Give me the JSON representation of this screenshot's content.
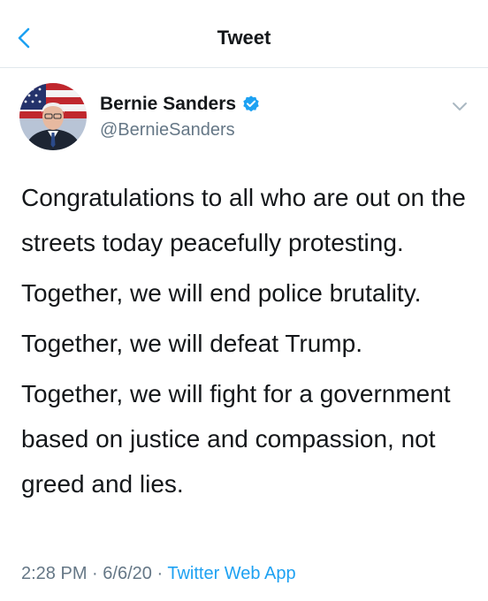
{
  "header": {
    "title": "Tweet",
    "back_icon": "chevron-left-icon"
  },
  "author": {
    "name": "Bernie Sanders",
    "handle": "@BernieSanders",
    "verified": true
  },
  "tweet": {
    "paragraphs": [
      "Congratulations to all who are out on the streets today peacefully protesting.",
      "Together, we will end police brutality.",
      "Together, we will defeat Trump.",
      "Together, we will fight for a government based on justice and compassion, not greed and lies."
    ]
  },
  "meta": {
    "time": "2:28 PM",
    "sep1": "·",
    "date": "6/6/20",
    "sep2": "·",
    "source": "Twitter Web App"
  },
  "colors": {
    "accent": "#1da1f2",
    "text": "#14171a",
    "muted": "#657786",
    "divider": "#e1e8ed"
  }
}
